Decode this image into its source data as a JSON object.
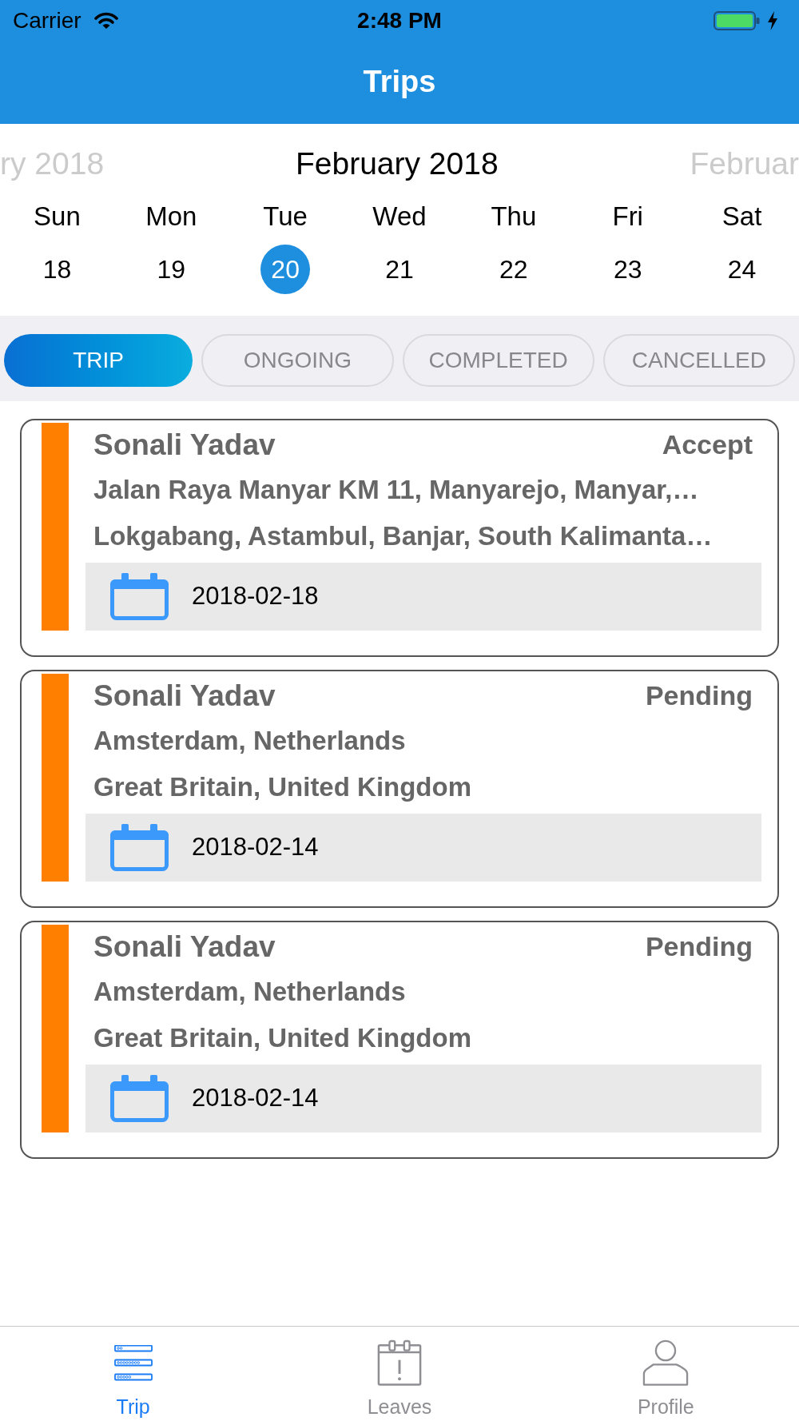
{
  "status_bar": {
    "carrier": "Carrier",
    "time": "2:48 PM"
  },
  "header": {
    "title": "Trips"
  },
  "calendar": {
    "prev_month": "ry 2018",
    "month": "February 2018",
    "next_month": "Februar",
    "days": [
      {
        "weekday": "Sun",
        "date": "18",
        "selected": false
      },
      {
        "weekday": "Mon",
        "date": "19",
        "selected": false
      },
      {
        "weekday": "Tue",
        "date": "20",
        "selected": true
      },
      {
        "weekday": "Wed",
        "date": "21",
        "selected": false
      },
      {
        "weekday": "Thu",
        "date": "22",
        "selected": false
      },
      {
        "weekday": "Fri",
        "date": "23",
        "selected": false
      },
      {
        "weekday": "Sat",
        "date": "24",
        "selected": false
      }
    ]
  },
  "filters": [
    {
      "label": "TRIP",
      "selected": true
    },
    {
      "label": "ONGOING",
      "selected": false
    },
    {
      "label": "COMPLETED",
      "selected": false
    },
    {
      "label": "CANCELLED",
      "selected": false
    }
  ],
  "trips": [
    {
      "name": "Sonali Yadav",
      "status": "Accept",
      "pickup": "Jalan Raya Manyar KM 11, Manyarejo, Manyar,…",
      "dropoff": "Lokgabang, Astambul, Banjar, South Kalimanta…",
      "date": "2018-02-18"
    },
    {
      "name": "Sonali Yadav",
      "status": "Pending",
      "pickup": "Amsterdam, Netherlands",
      "dropoff": "Great Britain, United Kingdom",
      "date": "2018-02-14"
    },
    {
      "name": "Sonali Yadav",
      "status": "Pending",
      "pickup": "Amsterdam, Netherlands",
      "dropoff": "Great Britain, United Kingdom",
      "date": "2018-02-14"
    }
  ],
  "tab_bar": [
    {
      "label": "Trip",
      "selected": true
    },
    {
      "label": "Leaves",
      "selected": false
    },
    {
      "label": "Profile",
      "selected": false
    }
  ]
}
